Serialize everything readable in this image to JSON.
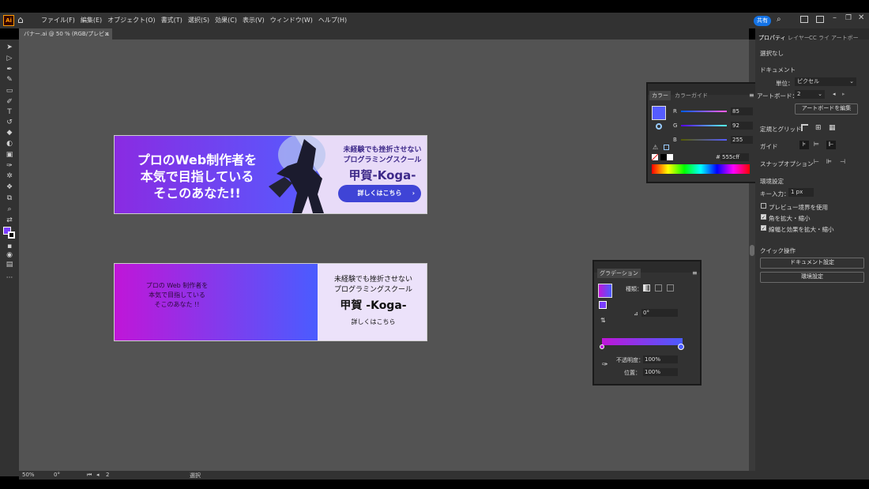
{
  "app": {
    "logo": "Ai",
    "home_icon": "home-icon"
  },
  "menu": [
    "ファイル(F)",
    "編集(E)",
    "オブジェクト(O)",
    "書式(T)",
    "選択(S)",
    "効果(C)",
    "表示(V)",
    "ウィンドウ(W)",
    "ヘルプ(H)"
  ],
  "titlebar": {
    "share_label": "共有"
  },
  "document_tab": {
    "title": "バナー.ai @ 50 % (RGB/プレビュー)",
    "close": "×"
  },
  "banner1": {
    "headline": [
      "プロのWeb制作者を",
      "本気で目指している",
      "そこのあなた!!"
    ],
    "sub": [
      "未経験でも挫折させない",
      "プログラミングスクール"
    ],
    "name": "甲賀-Koga-",
    "button": "詳しくはこちら"
  },
  "banner2": {
    "headline": [
      "プロの Web 制作者を",
      "本気で目指している",
      "そこのあなた !!"
    ],
    "sub": [
      "未経験でも挫折させない",
      "プログラミングスクール"
    ],
    "name": "甲賀 -Koga-",
    "link": "詳しくはこちら"
  },
  "color_panel": {
    "tabs": [
      "カラー",
      "カラーガイド"
    ],
    "channels": [
      {
        "label": "R",
        "value": "85"
      },
      {
        "label": "G",
        "value": "92"
      },
      {
        "label": "B",
        "value": "255"
      }
    ],
    "hex_prefix": "#",
    "hex": "555cff",
    "swatch": "#555cff"
  },
  "gradient_panel": {
    "tab": "グラデーション",
    "type_label": "種類：",
    "angle": "0°",
    "opacity_label": "不透明度：",
    "opacity": "100%",
    "position_label": "位置：",
    "position": "100%",
    "start_color": "#c016d8",
    "end_color": "#4a5cff"
  },
  "right_panel": {
    "tabs": [
      "プロパティ",
      "レイヤー",
      "CC ライ",
      "アートボー"
    ],
    "selection": "選択なし",
    "document_heading": "ドキュメント",
    "unit_label": "単位：",
    "unit": "ピクセル",
    "artboard_label": "アートボード：",
    "artboard": "2",
    "edit_artboards": "アートボードを編集",
    "rulers_grids": "定規とグリッド",
    "guides": "ガイド",
    "snap_options": "スナップオプション",
    "preferences": "環境設定",
    "key_increment_label": "キー入力：",
    "key_increment": "1 px",
    "checkboxes": [
      {
        "label": "プレビュー境界を使用",
        "checked": false
      },
      {
        "label": "角を拡大・縮小",
        "checked": true
      },
      {
        "label": "線幅と効果を拡大・縮小",
        "checked": true
      }
    ],
    "quick_actions": "クイック操作",
    "document_setup": "ドキュメント設定",
    "preferences_button": "環境設定"
  },
  "status": {
    "zoom": "50%",
    "rotation": "0°",
    "artboard": "2",
    "tool": "選択"
  }
}
